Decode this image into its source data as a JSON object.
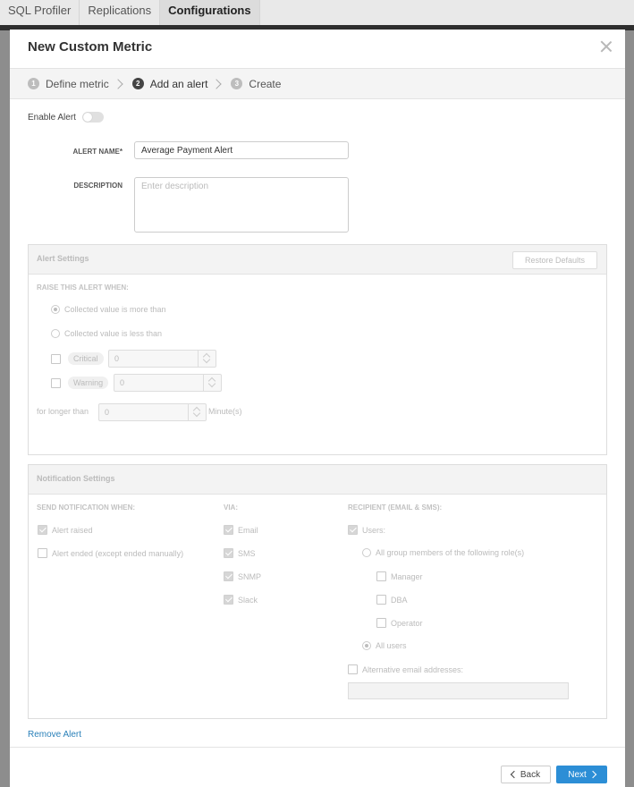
{
  "app": {
    "tabs": [
      {
        "label": "SQL Profiler",
        "active": false
      },
      {
        "label": "Replications",
        "active": false
      },
      {
        "label": "Configurations",
        "active": true
      }
    ]
  },
  "modal": {
    "title": "New Custom Metric",
    "steps": [
      {
        "num": "1",
        "label": "Define metric",
        "state": "done"
      },
      {
        "num": "2",
        "label": "Add an alert",
        "state": "active"
      },
      {
        "num": "3",
        "label": "Create",
        "state": "pending"
      }
    ],
    "enable_alert": {
      "label": "Enable Alert",
      "on": false
    },
    "alert_name": {
      "label": "ALERT NAME*",
      "value": "Average Payment Alert"
    },
    "description": {
      "label": "DESCRIPTION",
      "placeholder": "Enter description",
      "value": ""
    }
  },
  "alert_settings": {
    "title": "Alert Settings",
    "restore_label": "Restore Defaults",
    "raise_when_label": "RAISE THIS ALERT WHEN:",
    "options": [
      {
        "label": "Collected value is more than",
        "checked": true
      },
      {
        "label": "Collected value is less than",
        "checked": false
      }
    ],
    "critical": {
      "label": "Critical",
      "value": "0",
      "checked": false
    },
    "warning": {
      "label": "Warning",
      "value": "0",
      "checked": false
    },
    "longer_than": {
      "label": "for longer than",
      "value": "0",
      "unit": "Minute(s)"
    }
  },
  "notification_settings": {
    "title": "Notification Settings",
    "send_when_label": "SEND NOTIFICATION WHEN:",
    "send_when": [
      {
        "label": "Alert raised",
        "checked": true
      },
      {
        "label": "Alert ended (except ended manually)",
        "checked": false
      }
    ],
    "via_label": "VIA:",
    "via": [
      {
        "label": "Email",
        "checked": true
      },
      {
        "label": "SMS",
        "checked": true
      },
      {
        "label": "SNMP",
        "checked": true
      },
      {
        "label": "Slack",
        "checked": true
      }
    ],
    "recipient_label": "RECIPIENT (EMAIL & SMS):",
    "users": {
      "label": "Users:",
      "checked": true
    },
    "group_members": {
      "label": "All group members of the following role(s)",
      "checked": false
    },
    "roles": [
      {
        "label": "Manager",
        "checked": false
      },
      {
        "label": "DBA",
        "checked": false
      },
      {
        "label": "Operator",
        "checked": false
      }
    ],
    "all_users": {
      "label": "All users",
      "checked": true
    },
    "alt_emails": {
      "label": "Alternative email addresses:",
      "checked": false,
      "value": ""
    }
  },
  "footer": {
    "remove_label": "Remove Alert",
    "back_label": "Back",
    "next_label": "Next"
  },
  "colors": {
    "accent": "#2c8ed6",
    "link": "#2a80b9"
  }
}
